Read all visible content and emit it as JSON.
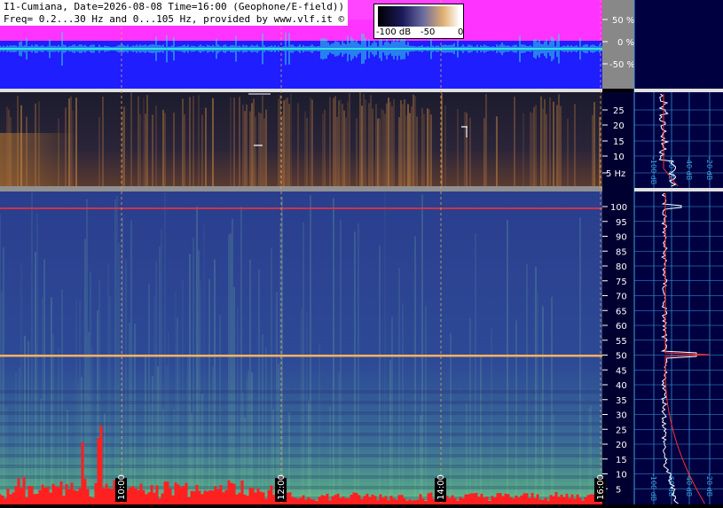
{
  "header": {
    "line1": "I1-Cumiana, Date=2026-08-08 Time=16:00 (Geophone/E-field))",
    "line2": "Freq= 0.2...30 Hz and 0...105 Hz, provided by www.vlf.it ©"
  },
  "colorbar": {
    "labels": [
      "-100 dB",
      "-50",
      "0"
    ]
  },
  "amplitude_panel": {
    "ticks": [
      "50 %",
      "0 %",
      "-50 %"
    ],
    "colors": {
      "background": "#1e1eff",
      "envelope": "#ff33ff",
      "trace": "#33e0e0"
    }
  },
  "low_freq_panel": {
    "ticks": [
      "25",
      "20",
      "15",
      "10",
      "5 Hz"
    ]
  },
  "high_freq_panel": {
    "ticks": [
      "100",
      "95",
      "90",
      "85",
      "80",
      "75",
      "70",
      "65",
      "60",
      "55",
      "50",
      "45",
      "40",
      "35",
      "30",
      "25",
      "20",
      "15",
      "10",
      "5"
    ]
  },
  "time_axis": {
    "labels": [
      "10:00",
      "12:00",
      "14:00",
      "16:00"
    ]
  },
  "spectrum_top": {
    "labels": [
      "-100 dB",
      "-60 dB",
      "-40 dB",
      "-20 dB"
    ]
  },
  "spectrum_bottom": {
    "labels": [
      "-100 dB",
      "-60 dB",
      "-40 dB",
      "-20 dB"
    ]
  },
  "colors": {
    "accent_red": "#ff2020",
    "grid_cyan": "#3aa0e0",
    "axis_panel": "#888888",
    "spectrum_bg": "#000040"
  }
}
